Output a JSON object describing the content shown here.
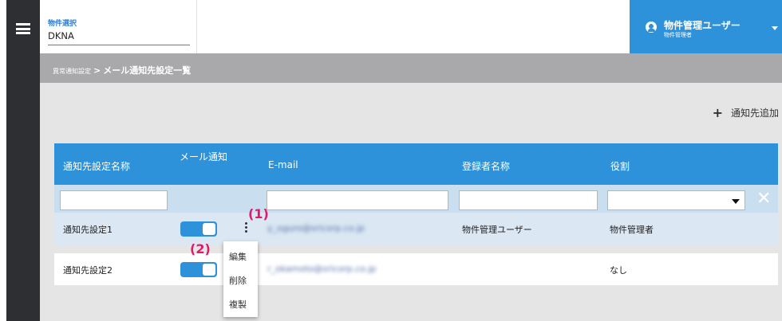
{
  "header": {
    "property_select": {
      "label": "物件選択",
      "value": "DKNA"
    },
    "user": {
      "name": "物件管理ユーザー",
      "role": "物件管理者",
      "icon": "user-circle-icon"
    },
    "menu_icon": "hamburger-menu-icon",
    "accent_color": "#2e92db"
  },
  "breadcrumb": {
    "parent": "異常通知設定",
    "separator": ">",
    "current": "メール通知先設定一覧"
  },
  "toolbar": {
    "add_label": "通知先追加",
    "add_icon": "plus-icon"
  },
  "table": {
    "columns": [
      "通知先設定名称",
      "メール通知",
      "E-mail",
      "登録者名称",
      "役割"
    ],
    "filters": {
      "role_placeholder": ""
    },
    "rows": [
      {
        "name": "通知先設定1",
        "mail_notify": true,
        "email": "y_oguro@sricorp.co.jp",
        "registrant": "物件管理ユーザー",
        "role": "物件管理者"
      },
      {
        "name": "通知先設定2",
        "mail_notify": true,
        "email": "r_okamoto@sricorp.co.jp",
        "registrant": "",
        "role": "なし"
      }
    ]
  },
  "context_menu": {
    "items": [
      "編集",
      "削除",
      "複製"
    ]
  },
  "annotations": {
    "one": "(1)",
    "two": "(2)"
  }
}
